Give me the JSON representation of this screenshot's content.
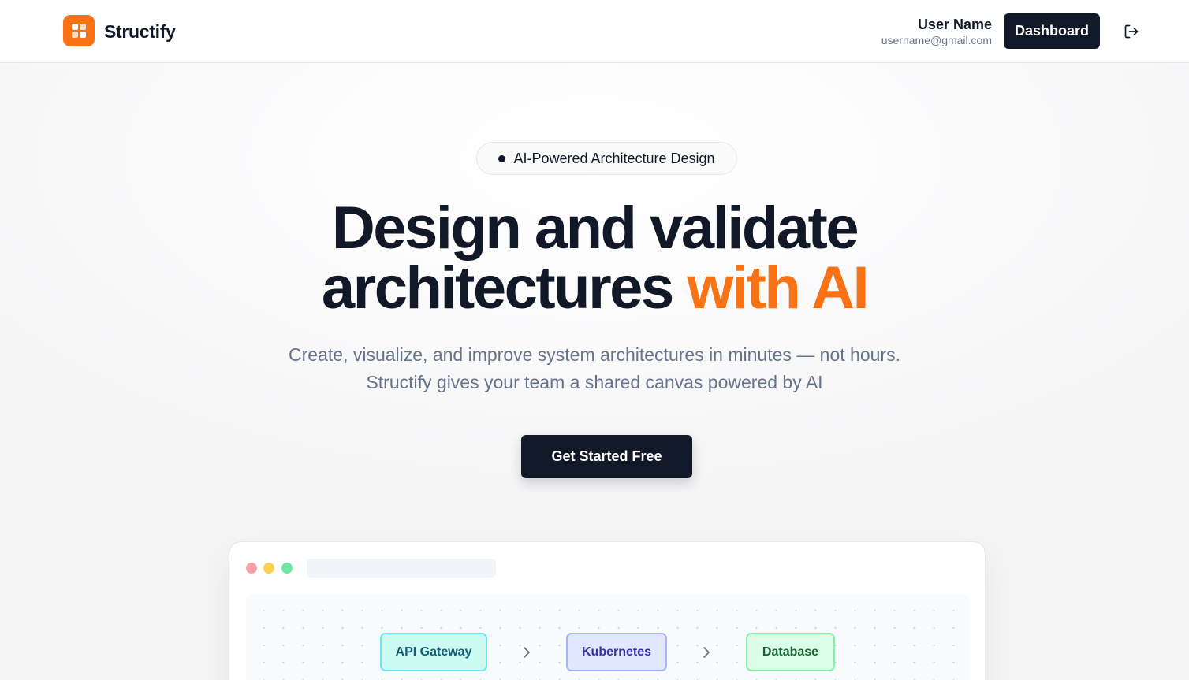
{
  "header": {
    "brand": "Structify",
    "user": {
      "name": "User Name",
      "email": "username@gmail.com"
    },
    "dashboard_label": "Dashboard",
    "logout_icon": "logout-icon"
  },
  "hero": {
    "badge": "AI-Powered Architecture Design",
    "headline_line1": "Design and validate",
    "headline_line2_main": "architectures",
    "headline_line2_accent": "with AI",
    "subline1": "Create, visualize, and improve system architectures in minutes — not hours.",
    "subline2": "Structify gives your team a shared canvas powered by AI",
    "cta_label": "Get Started Free"
  },
  "preview": {
    "nodes": [
      "API Gateway",
      "Kubernetes",
      "Database"
    ]
  },
  "colors": {
    "accent": "#f97316",
    "dark": "#111827",
    "muted": "#64748b"
  }
}
